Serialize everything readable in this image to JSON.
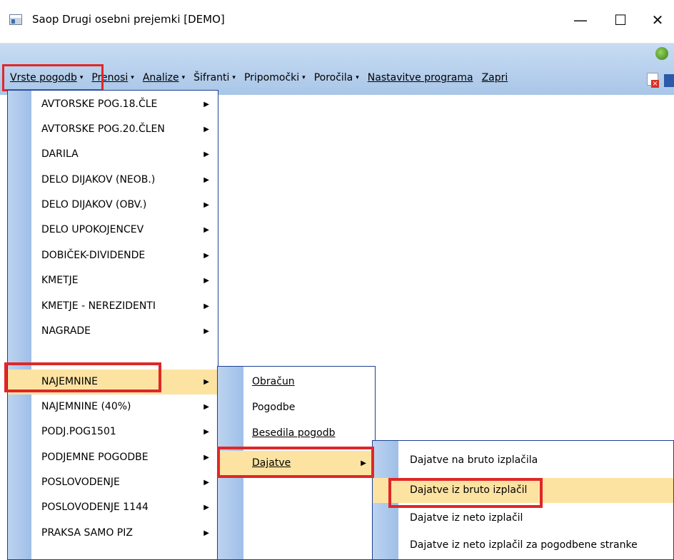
{
  "window": {
    "title": "Saop Drugi osebni prejemki [DEMO]"
  },
  "titlebar_buttons": {
    "minimize": "—",
    "maximize": "☐",
    "close": "✕"
  },
  "menubar": [
    {
      "label": "Vrste pogodb",
      "has_arrow": true
    },
    {
      "label": "Prenosi",
      "has_arrow": true
    },
    {
      "label": "Analize",
      "has_arrow": true
    },
    {
      "label": "Šifranti",
      "has_arrow": true
    },
    {
      "label": "Pripomočki",
      "has_arrow": true
    },
    {
      "label": "Poročila",
      "has_arrow": true
    },
    {
      "label": "Nastavitve programa",
      "has_arrow": false
    },
    {
      "label": "Zapri",
      "has_arrow": false
    }
  ],
  "contract_types_menu": [
    "AVTORSKE POG.18.ČLE",
    "AVTORSKE POG.20.ČLEN",
    "DARILA",
    "DELO DIJAKOV (NEOB.)",
    "DELO DIJAKOV (OBV.)",
    "DELO UPOKOJENCEV",
    "DOBIČEK-DIVIDENDE",
    "KMETJE",
    "KMETJE - NEREZIDENTI",
    "NAGRADE",
    "NAJEMNINE",
    "NAJEMNINE (40%)",
    "PODJ.POG1501",
    "PODJEMNE POGODBE",
    "POSLOVODENJE",
    "POSLOVODENJE 1144",
    "PRAKSA SAMO PIZ"
  ],
  "najemnine_menu": [
    "Obračun",
    "Pogodbe",
    "Besedila pogodb",
    "Dajatve"
  ],
  "dajatve_menu": [
    "Dajatve na bruto izplačila",
    "Dajatve iz bruto izplačil",
    "Dajatve iz neto izplačil",
    "Dajatve iz neto izplačil za pogodbene stranke"
  ],
  "submenu_arrow": "▶",
  "menubar_arrow": "▾",
  "colors": {
    "highlight": "#fde3a2",
    "annotation": "#e02727",
    "menu_border": "#1c3f94"
  }
}
